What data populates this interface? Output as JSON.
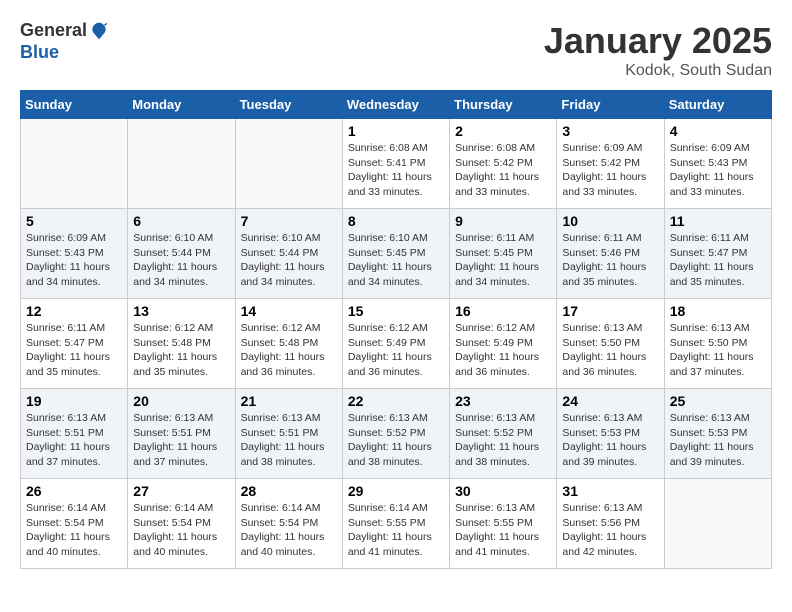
{
  "header": {
    "logo_line1": "General",
    "logo_line2": "Blue",
    "month": "January 2025",
    "location": "Kodok, South Sudan"
  },
  "weekdays": [
    "Sunday",
    "Monday",
    "Tuesday",
    "Wednesday",
    "Thursday",
    "Friday",
    "Saturday"
  ],
  "weeks": [
    [
      {
        "day": "",
        "info": ""
      },
      {
        "day": "",
        "info": ""
      },
      {
        "day": "",
        "info": ""
      },
      {
        "day": "1",
        "info": "Sunrise: 6:08 AM\nSunset: 5:41 PM\nDaylight: 11 hours\nand 33 minutes."
      },
      {
        "day": "2",
        "info": "Sunrise: 6:08 AM\nSunset: 5:42 PM\nDaylight: 11 hours\nand 33 minutes."
      },
      {
        "day": "3",
        "info": "Sunrise: 6:09 AM\nSunset: 5:42 PM\nDaylight: 11 hours\nand 33 minutes."
      },
      {
        "day": "4",
        "info": "Sunrise: 6:09 AM\nSunset: 5:43 PM\nDaylight: 11 hours\nand 33 minutes."
      }
    ],
    [
      {
        "day": "5",
        "info": "Sunrise: 6:09 AM\nSunset: 5:43 PM\nDaylight: 11 hours\nand 34 minutes."
      },
      {
        "day": "6",
        "info": "Sunrise: 6:10 AM\nSunset: 5:44 PM\nDaylight: 11 hours\nand 34 minutes."
      },
      {
        "day": "7",
        "info": "Sunrise: 6:10 AM\nSunset: 5:44 PM\nDaylight: 11 hours\nand 34 minutes."
      },
      {
        "day": "8",
        "info": "Sunrise: 6:10 AM\nSunset: 5:45 PM\nDaylight: 11 hours\nand 34 minutes."
      },
      {
        "day": "9",
        "info": "Sunrise: 6:11 AM\nSunset: 5:45 PM\nDaylight: 11 hours\nand 34 minutes."
      },
      {
        "day": "10",
        "info": "Sunrise: 6:11 AM\nSunset: 5:46 PM\nDaylight: 11 hours\nand 35 minutes."
      },
      {
        "day": "11",
        "info": "Sunrise: 6:11 AM\nSunset: 5:47 PM\nDaylight: 11 hours\nand 35 minutes."
      }
    ],
    [
      {
        "day": "12",
        "info": "Sunrise: 6:11 AM\nSunset: 5:47 PM\nDaylight: 11 hours\nand 35 minutes."
      },
      {
        "day": "13",
        "info": "Sunrise: 6:12 AM\nSunset: 5:48 PM\nDaylight: 11 hours\nand 35 minutes."
      },
      {
        "day": "14",
        "info": "Sunrise: 6:12 AM\nSunset: 5:48 PM\nDaylight: 11 hours\nand 36 minutes."
      },
      {
        "day": "15",
        "info": "Sunrise: 6:12 AM\nSunset: 5:49 PM\nDaylight: 11 hours\nand 36 minutes."
      },
      {
        "day": "16",
        "info": "Sunrise: 6:12 AM\nSunset: 5:49 PM\nDaylight: 11 hours\nand 36 minutes."
      },
      {
        "day": "17",
        "info": "Sunrise: 6:13 AM\nSunset: 5:50 PM\nDaylight: 11 hours\nand 36 minutes."
      },
      {
        "day": "18",
        "info": "Sunrise: 6:13 AM\nSunset: 5:50 PM\nDaylight: 11 hours\nand 37 minutes."
      }
    ],
    [
      {
        "day": "19",
        "info": "Sunrise: 6:13 AM\nSunset: 5:51 PM\nDaylight: 11 hours\nand 37 minutes."
      },
      {
        "day": "20",
        "info": "Sunrise: 6:13 AM\nSunset: 5:51 PM\nDaylight: 11 hours\nand 37 minutes."
      },
      {
        "day": "21",
        "info": "Sunrise: 6:13 AM\nSunset: 5:51 PM\nDaylight: 11 hours\nand 38 minutes."
      },
      {
        "day": "22",
        "info": "Sunrise: 6:13 AM\nSunset: 5:52 PM\nDaylight: 11 hours\nand 38 minutes."
      },
      {
        "day": "23",
        "info": "Sunrise: 6:13 AM\nSunset: 5:52 PM\nDaylight: 11 hours\nand 38 minutes."
      },
      {
        "day": "24",
        "info": "Sunrise: 6:13 AM\nSunset: 5:53 PM\nDaylight: 11 hours\nand 39 minutes."
      },
      {
        "day": "25",
        "info": "Sunrise: 6:13 AM\nSunset: 5:53 PM\nDaylight: 11 hours\nand 39 minutes."
      }
    ],
    [
      {
        "day": "26",
        "info": "Sunrise: 6:14 AM\nSunset: 5:54 PM\nDaylight: 11 hours\nand 40 minutes."
      },
      {
        "day": "27",
        "info": "Sunrise: 6:14 AM\nSunset: 5:54 PM\nDaylight: 11 hours\nand 40 minutes."
      },
      {
        "day": "28",
        "info": "Sunrise: 6:14 AM\nSunset: 5:54 PM\nDaylight: 11 hours\nand 40 minutes."
      },
      {
        "day": "29",
        "info": "Sunrise: 6:14 AM\nSunset: 5:55 PM\nDaylight: 11 hours\nand 41 minutes."
      },
      {
        "day": "30",
        "info": "Sunrise: 6:13 AM\nSunset: 5:55 PM\nDaylight: 11 hours\nand 41 minutes."
      },
      {
        "day": "31",
        "info": "Sunrise: 6:13 AM\nSunset: 5:56 PM\nDaylight: 11 hours\nand 42 minutes."
      },
      {
        "day": "",
        "info": ""
      }
    ]
  ]
}
